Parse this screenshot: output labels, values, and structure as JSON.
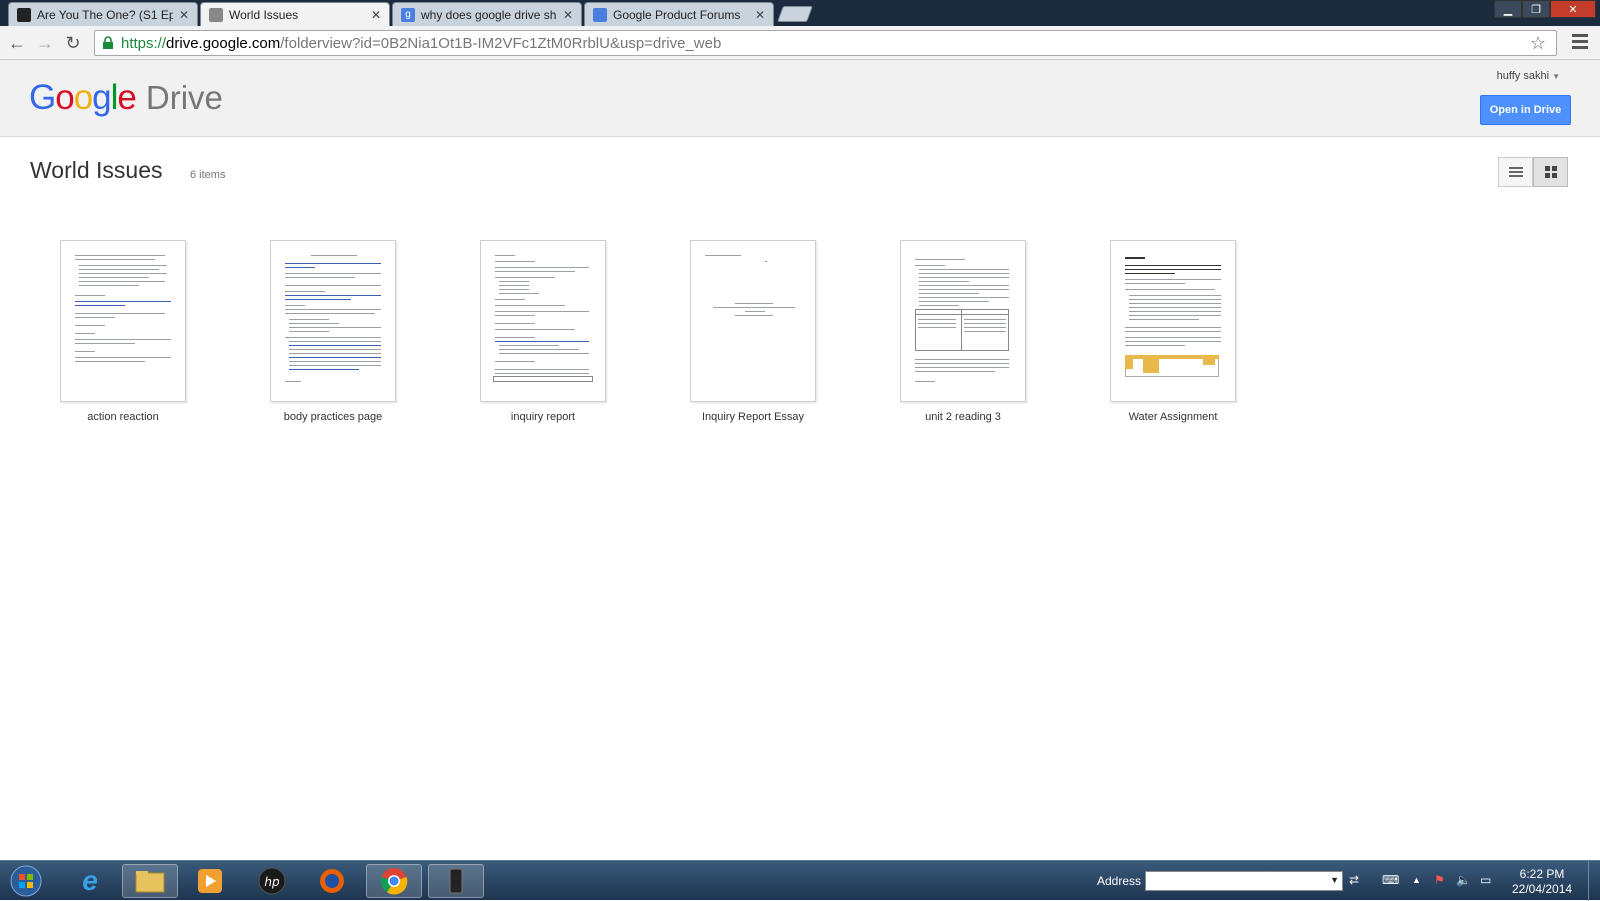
{
  "browser": {
    "tabs": [
      {
        "title": "Are You The One? (S1 Ep",
        "favicon": "mtv",
        "active": false
      },
      {
        "title": "World Issues",
        "favicon": "folder",
        "active": true
      },
      {
        "title": "why does google drive sh",
        "favicon": "google",
        "active": false
      },
      {
        "title": "Google Product Forums",
        "favicon": "forums",
        "active": false
      }
    ],
    "url_scheme": "https://",
    "url_host": "drive.google.com",
    "url_rest": "/folderview?id=0B2Nia1Ot1B-IM2VFc1ZtM0RrblU&usp=drive_web"
  },
  "drive": {
    "logo_letters": [
      "G",
      "o",
      "o",
      "g",
      "l",
      "e"
    ],
    "product": "Drive",
    "user": "huffy sakhi",
    "open_button": "Open in Drive",
    "folder_title": "World Issues",
    "item_count": "6 items",
    "files": [
      {
        "name": "action reaction"
      },
      {
        "name": "body practices page"
      },
      {
        "name": "inquiry report"
      },
      {
        "name": "Inquiry Report Essay"
      },
      {
        "name": "unit 2 reading 3"
      },
      {
        "name": "Water Assignment"
      }
    ]
  },
  "taskbar": {
    "address_label": "Address",
    "time": "6:22 PM",
    "date": "22/04/2014"
  },
  "colors": {
    "accent": "#4d90fe",
    "tabstrip": "#1b2a3d",
    "taskbar": "#1d3550"
  }
}
